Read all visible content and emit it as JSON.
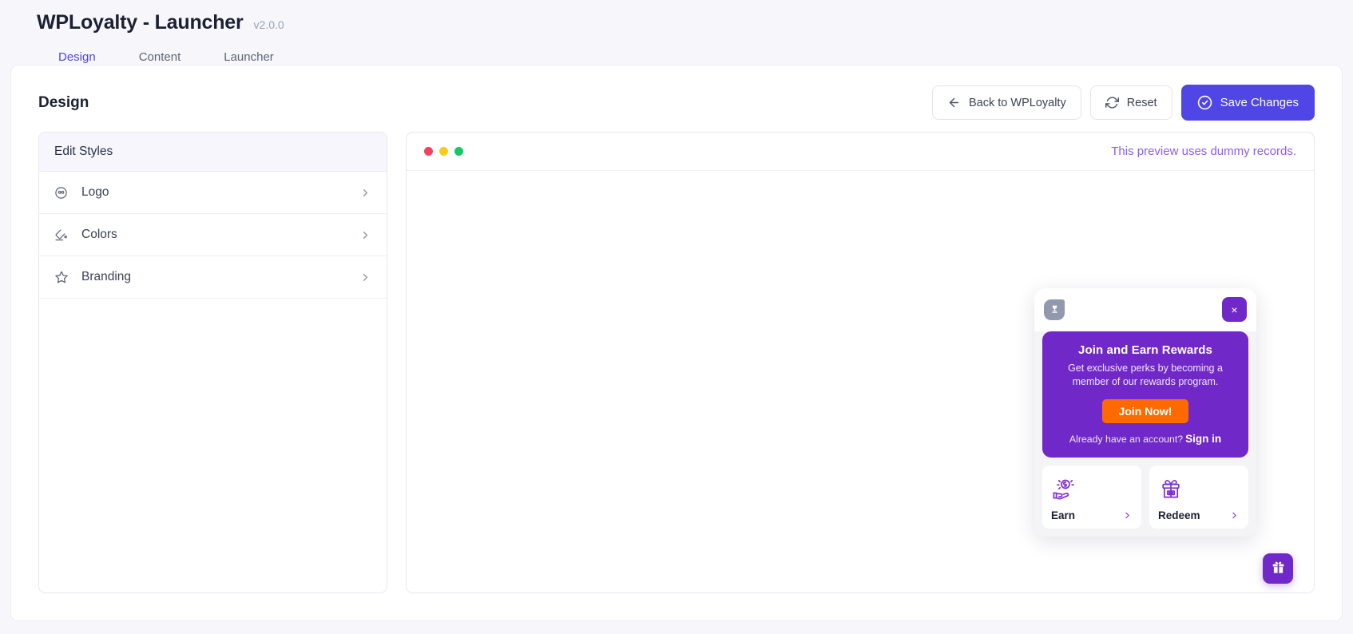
{
  "header": {
    "title": "WPLoyalty - Launcher",
    "version": "v2.0.0",
    "tabs": [
      {
        "label": "Design",
        "active": true
      },
      {
        "label": "Content",
        "active": false
      },
      {
        "label": "Launcher",
        "active": false
      }
    ]
  },
  "page": {
    "title": "Design",
    "toolbar": {
      "back_label": "Back to WPLoyalty",
      "reset_label": "Reset",
      "save_label": "Save Changes"
    }
  },
  "sidebar": {
    "heading": "Edit Styles",
    "items": [
      {
        "label": "Logo",
        "icon": "logo-icon"
      },
      {
        "label": "Colors",
        "icon": "paint-bucket-icon"
      },
      {
        "label": "Branding",
        "icon": "star-icon"
      }
    ]
  },
  "preview": {
    "note": "This preview uses dummy records.",
    "dots": [
      "red",
      "yellow",
      "green"
    ]
  },
  "widget": {
    "close_label": "×",
    "join": {
      "title": "Join and Earn Rewards",
      "description": "Get exclusive perks by becoming a member of our rewards program.",
      "button_label": "Join Now!",
      "footer_text": "Already have an account?",
      "signin_label": "Sign in"
    },
    "tiles": [
      {
        "label": "Earn",
        "icon": "hand-coin-icon"
      },
      {
        "label": "Redeem",
        "icon": "gift-icon"
      }
    ]
  },
  "colors": {
    "accent_indigo": "#4f46e5",
    "widget_purple": "#7028c8",
    "cta_orange": "#ff6a00",
    "note_purple": "#8b5cf6"
  }
}
